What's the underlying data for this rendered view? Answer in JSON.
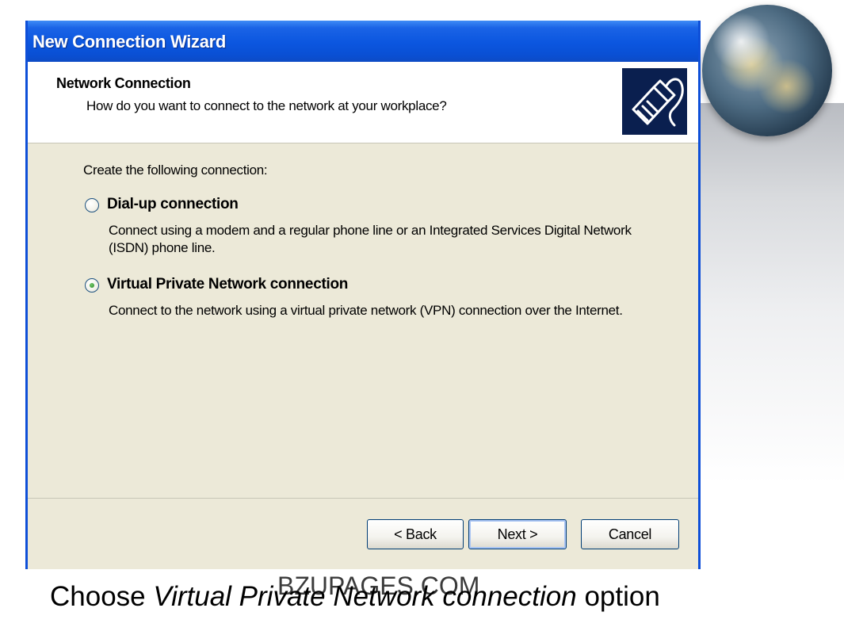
{
  "window": {
    "title": "New Connection Wizard"
  },
  "header": {
    "title": "Network Connection",
    "subtitle": "How do you want to connect to the network at your workplace?",
    "icon": "network-plug-icon"
  },
  "body": {
    "prompt": "Create the following connection:",
    "options": [
      {
        "label": "Dial-up connection",
        "description": "Connect using a modem and a regular phone line or an Integrated Services Digital Network (ISDN) phone line.",
        "selected": false
      },
      {
        "label": "Virtual Private Network connection",
        "description": "Connect to the network using a virtual private network (VPN) connection over the Internet.",
        "selected": true
      }
    ]
  },
  "buttons": {
    "back": "< Back",
    "next": "Next >",
    "cancel": "Cancel"
  },
  "slide": {
    "caption_start": "Choose",
    "caption_emphasis": "Virtual Private Network connection",
    "caption_end": "option",
    "watermark": "BZUPAGES.COM"
  }
}
